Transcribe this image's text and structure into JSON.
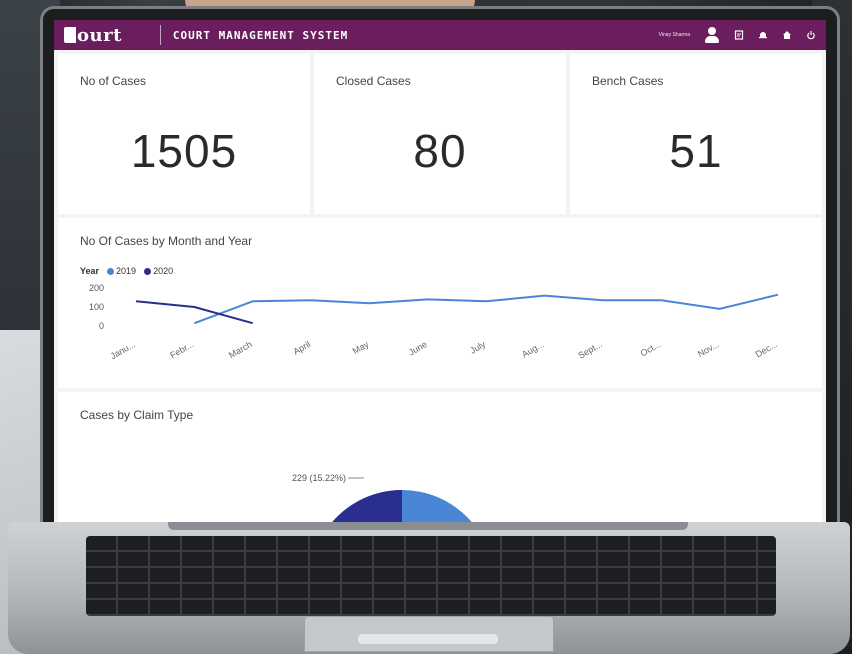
{
  "header": {
    "logo_text": "ourt",
    "title": "COURT MANAGEMENT SYSTEM",
    "user_name": "Vinay Sharma"
  },
  "icons": {
    "user": "user-icon",
    "icon1": "document-icon",
    "icon2": "bell-icon",
    "icon3": "home-icon",
    "icon4": "power-icon"
  },
  "kpis": [
    {
      "label": "No of Cases",
      "value": "1505"
    },
    {
      "label": "Closed Cases",
      "value": "80"
    },
    {
      "label": "Bench Cases",
      "value": "51"
    }
  ],
  "line_chart": {
    "title": "No Of Cases by Month and Year",
    "legend_title": "Year",
    "series_names": [
      "2019",
      "2020"
    ]
  },
  "pie_chart": {
    "title": "Cases by Claim Type",
    "label": "229 (15.22%)"
  },
  "colors": {
    "header_bg": "#6b1e5d",
    "series_2019": "#4a86d6",
    "series_2020": "#2a2f8f"
  },
  "chart_data": [
    {
      "type": "line",
      "title": "No Of Cases by Month and Year",
      "categories": [
        "Janu...",
        "Febr...",
        "March",
        "April",
        "May",
        "June",
        "July",
        "Aug...",
        "Sept...",
        "Oct...",
        "Nov...",
        "Dec..."
      ],
      "ylim": [
        0,
        200
      ],
      "yticks": [
        0,
        100,
        200
      ],
      "legend_title": "Year",
      "legend_position": "top-left",
      "series": [
        {
          "name": "2019",
          "color": "#4a86d6",
          "values": [
            null,
            15,
            130,
            135,
            120,
            140,
            130,
            160,
            135,
            135,
            90,
            165
          ]
        },
        {
          "name": "2020",
          "color": "#2a2f8f",
          "values": [
            130,
            100,
            15,
            null,
            null,
            null,
            null,
            null,
            null,
            null,
            null,
            null
          ]
        }
      ]
    },
    {
      "type": "pie",
      "title": "Cases by Claim Type",
      "slices": [
        {
          "value": 229,
          "percent": 15.22,
          "label": "229 (15.22%)"
        }
      ]
    }
  ]
}
